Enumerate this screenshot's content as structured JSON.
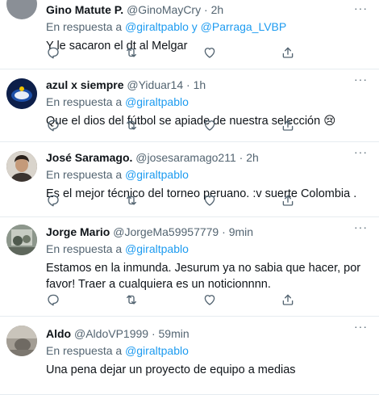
{
  "tweets": [
    {
      "name": "Gino Matute P.",
      "handle": "@GinoMayCry",
      "time": "2h",
      "reply_prefix": "En respuesta a ",
      "mention1": "@giraltpablo",
      "joiner": " y ",
      "mention2": "@Parraga_LVBP",
      "text": "Y le sacaron el dt al Melgar"
    },
    {
      "name": "azul x siempre",
      "handle": "@Yiduar14",
      "time": "1h",
      "reply_prefix": "En respuesta a ",
      "mention1": "@giraltpablo",
      "text": "Que el dios del fútbol se apiade de nuestra selección 😢"
    },
    {
      "name": "José Saramago.",
      "handle": "@josesaramago211",
      "time": "2h",
      "reply_prefix": "En respuesta a ",
      "mention1": "@giraltpablo",
      "text": "Es el mejor técnico del torneo peruano.  :v suerte Colombia ."
    },
    {
      "name": "Jorge Mario",
      "handle": "@JorgeMa59957779",
      "time": "9min",
      "reply_prefix": "En respuesta a ",
      "mention1": "@giraltpablo",
      "text": "Estamos en la inmunda. Jesurum ya no sabia que hacer, por favor! Traer a cualquiera es un noticionnnn."
    },
    {
      "name": "Aldo",
      "handle": "@AldoVP1999",
      "time": "59min",
      "reply_prefix": "En respuesta a ",
      "mention1": "@giraltpablo",
      "text": "Una pena dejar un proyecto de equipo a medias"
    }
  ],
  "separator": " · ",
  "more_icon": "···",
  "colors": {
    "link": "#1d9bf0",
    "secondary": "#536471",
    "primary_text": "#0f1419",
    "divider": "#e6ecf0"
  },
  "icons": [
    "reply-icon",
    "retweet-icon",
    "like-icon",
    "share-icon"
  ]
}
